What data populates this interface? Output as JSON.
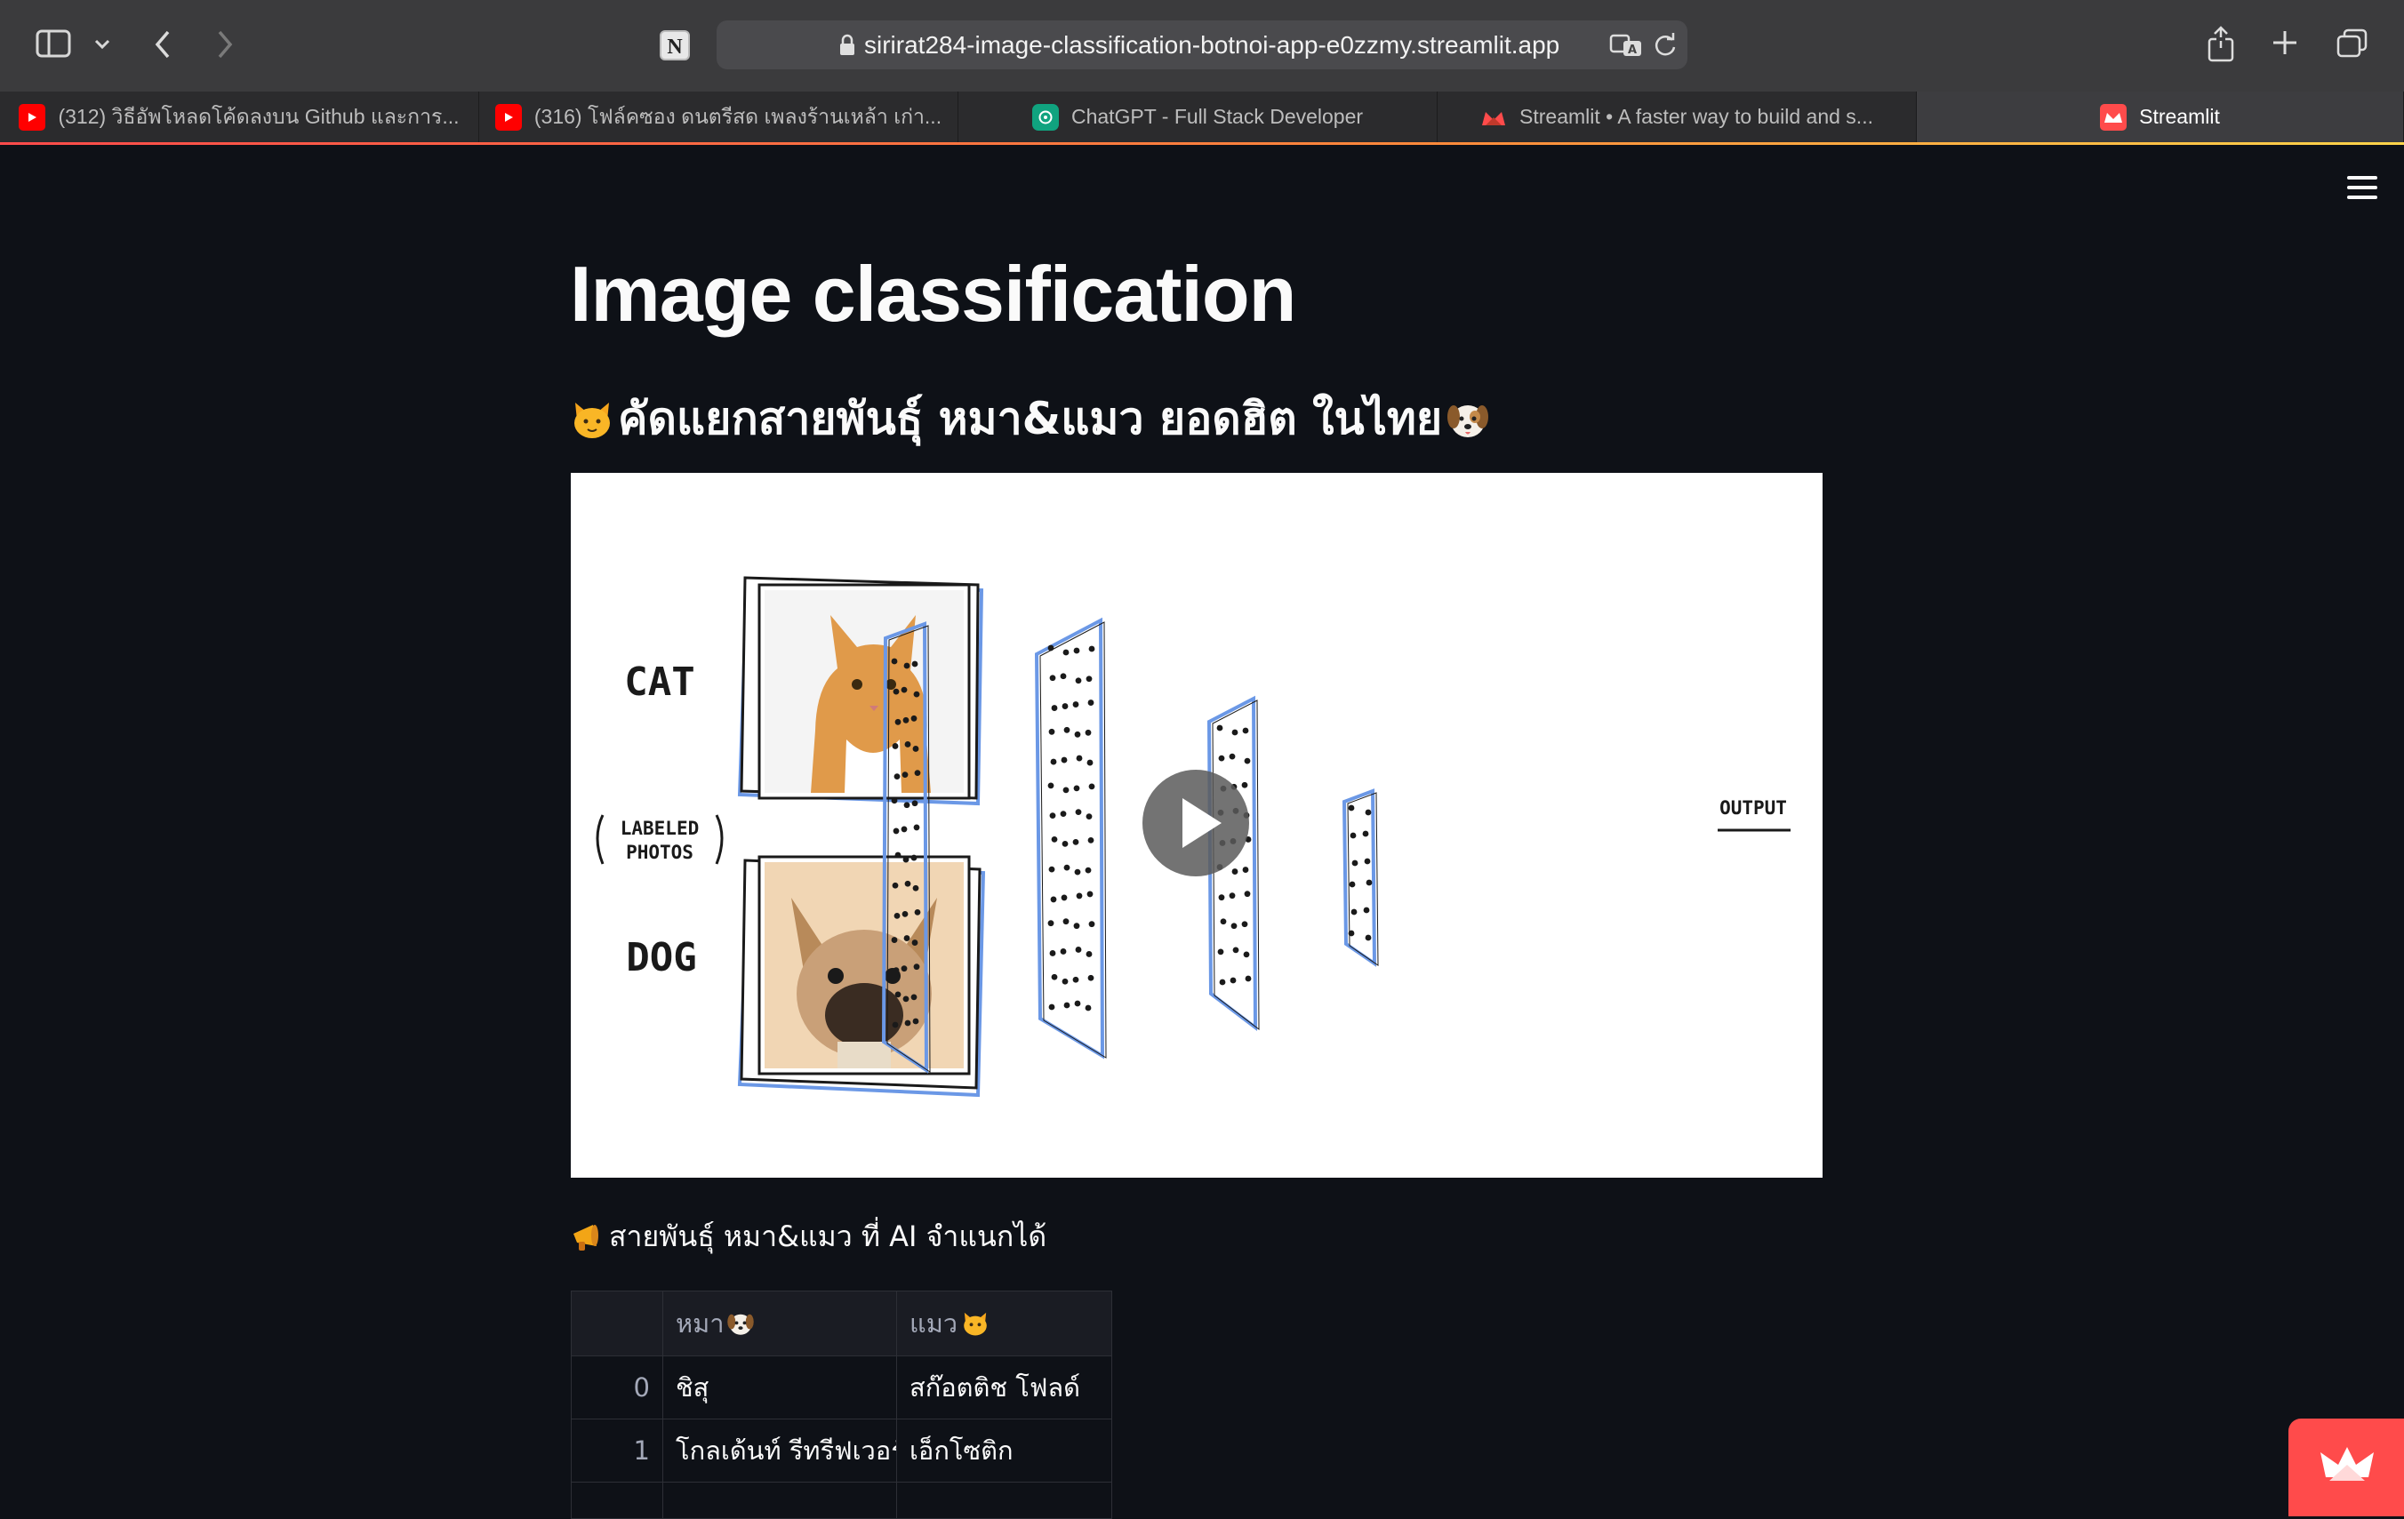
{
  "browser": {
    "url": "sirirat284-image-classification-botnoi-app-e0zzmy.streamlit.app",
    "tabs": [
      {
        "label": "(312) วิธีอัพโหลดโค้ดลงบน Github และการ...",
        "favicon": "youtube-icon"
      },
      {
        "label": "(316) โฟล์คซอง ดนตรีสด เพลงร้านเหล้า เก่า...",
        "favicon": "youtube-icon"
      },
      {
        "label": "ChatGPT - Full Stack Developer",
        "favicon": "chatgpt-icon"
      },
      {
        "label": "Streamlit • A faster way to build and s...",
        "favicon": "streamlit-icon"
      },
      {
        "label": "Streamlit",
        "favicon": "streamlit-icon",
        "active": true
      }
    ]
  },
  "page": {
    "title": "Image classification",
    "subtitle": "คัดแยกสายพันธุ์ หมา&แมว ยอดฮิต ในไทย",
    "video": {
      "labels": {
        "cat": "CAT",
        "labeled": "LABELED",
        "photos": "PHOTOS",
        "dog": "DOG",
        "output": "OUTPUT"
      }
    },
    "caption": "สายพันธุ์ หมา&แมว ที่ AI จำแนกได้",
    "table": {
      "headers": [
        "",
        "หมา",
        "แมว"
      ],
      "rows": [
        [
          "0",
          "ชิสุ",
          "สก๊อตติช โฟลด์"
        ],
        [
          "1",
          "โกลเด้นท์ รีทรีฟเวอร์",
          "เอ็กโซติก"
        ]
      ]
    }
  },
  "colors": {
    "background": "#0e1117",
    "text": "#fafafa",
    "accent": "#ff4b4b",
    "network_blue": "#6b98e6"
  }
}
